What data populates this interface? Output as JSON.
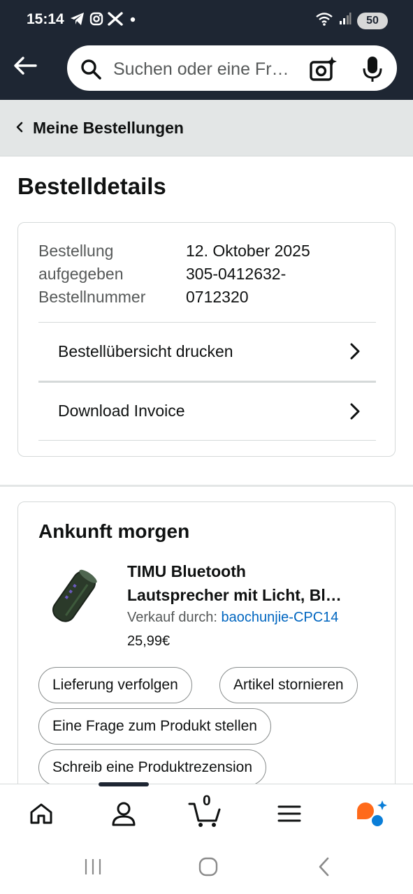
{
  "status_bar": {
    "time": "15:14",
    "battery": "50",
    "left_icons": [
      "telegram-icon",
      "instagram-icon",
      "x-icon",
      "dot-icon"
    ],
    "right_icons": [
      "wifi-icon",
      "signal-icon",
      "battery-icon"
    ]
  },
  "header": {
    "search_placeholder": "Suchen oder eine Fr…",
    "colors": {
      "bar": "#1e2633",
      "accent_link": "#0066c0"
    }
  },
  "breadcrumb": {
    "label": "Meine Bestellungen"
  },
  "page": {
    "title": "Bestelldetails"
  },
  "order": {
    "placed_label": "Bestellung aufgegeben",
    "placed_label_line1": "Bestellung",
    "placed_label_line2": "aufgegeben",
    "placed_date": "12. Oktober 2025",
    "number_label": "Bestellnummer",
    "number_line1": "305-0412632-",
    "number_line2": "0712320",
    "actions": [
      {
        "label": "Bestellübersicht drucken"
      },
      {
        "label": "Download Invoice"
      }
    ]
  },
  "shipment": {
    "arrival": "Ankunft morgen",
    "product": {
      "title_line1": "TIMU Bluetooth",
      "title_line2": "Lautsprecher mit Licht, Bl…",
      "seller_prefix": "Verkauf durch:",
      "seller": "baochunjie-CPC14",
      "price": "25,99€"
    },
    "buttons": [
      {
        "label": "Lieferung verfolgen"
      },
      {
        "label": "Artikel stornieren"
      },
      {
        "label": "Eine Frage zum Produkt stellen"
      },
      {
        "label": "Schreib eine Produktrezension"
      }
    ]
  },
  "bottom_nav": {
    "items": [
      "home-icon",
      "account-icon",
      "cart-icon",
      "menu-icon",
      "rufus-icon"
    ],
    "cart_count": "0"
  },
  "system_nav": [
    "recents-icon",
    "home-circle-icon",
    "back-icon"
  ]
}
